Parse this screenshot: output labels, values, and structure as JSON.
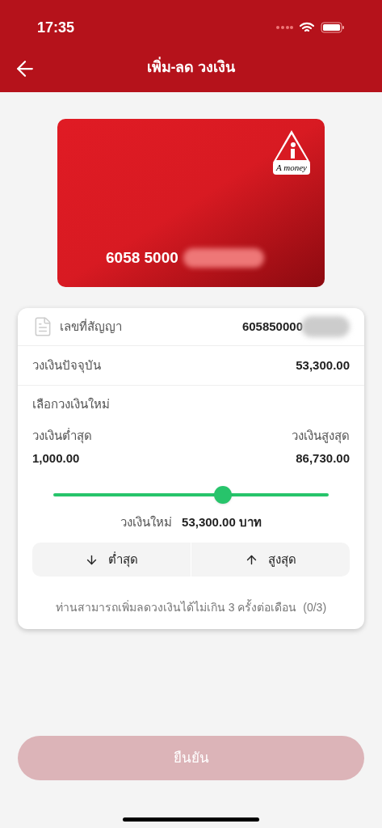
{
  "status_bar": {
    "time": "17:35"
  },
  "header": {
    "title": "เพิ่ม-ลด วงเงิน"
  },
  "card": {
    "logo_text": "A money",
    "number": "6058 5000"
  },
  "contract": {
    "label": "เลขที่สัญญา",
    "value": "605850000"
  },
  "current_limit": {
    "label": "วงเงินปัจจุบัน",
    "value": "53,300.00"
  },
  "new_limit": {
    "label": "เลือกวงเงินใหม่",
    "min_label": "วงเงินต่ำสุด",
    "min_value": "1,000.00",
    "max_label": "วงเงินสูงสุด",
    "max_value": "86,730.00",
    "slider": {
      "level": 0.615
    },
    "result_label": "วงเงินใหม่",
    "result_value": "53,300.00 บาท"
  },
  "quick_buttons": [
    {
      "kind": "down",
      "label": "ต่ำสุด"
    },
    {
      "kind": "up",
      "label": "สูงสุด"
    }
  ],
  "note": "ท่านสามารถเพิ่มลดวงเงินได้ไม่เกิน 3 ครั้งต่อเดือน  (0/3)",
  "confirm_button": {
    "label": "ยืนยัน",
    "disabled": true
  }
}
